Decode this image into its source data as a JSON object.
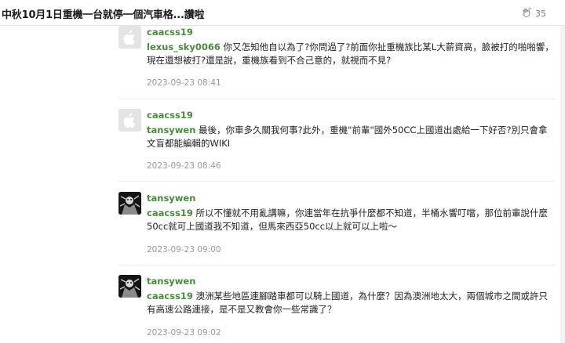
{
  "header": {
    "title": "中秋10月1日重機一台就停一個汽車格...讚啦",
    "like_count": "35"
  },
  "comments": [
    {
      "author": "caacss19",
      "mention": "lexus_sky0066",
      "text": " 你又怎知他自以為了?你問過了?前面你扯重機族比某L大薪資高，臉被打的啪啪響，現在還想被打?還是說，重機族看到不合己意的，就視而不見?",
      "time": "2023-09-23 08:41",
      "avatar": "default-avatar-icon"
    },
    {
      "author": "caacss19",
      "mention": "tansywen",
      "text": " 最後，你車多久關我何事?此外，重機\"前輩\"國外50CC上國道出處給一下好否?別只會拿文盲都能編輯的WIKI",
      "time": "2023-09-23 08:46",
      "avatar": "default-avatar-icon"
    },
    {
      "author": "tansywen",
      "mention": "caacss19",
      "text": " 所以不懂就不用亂講嘛，你連當年在抗爭什麼都不知道，半桶水響叮噹，那位前輩說什麼50cc就可上國道我不知道，但馬來西亞50cc以上就可以上啦～",
      "time": "2023-09-23 09:00",
      "avatar": "photo-avatar-icon"
    },
    {
      "author": "tansywen",
      "mention": "caacss19",
      "text": " 澳洲某些地區連腳踏車都可以騎上國道，為什麼？因為澳洲地太大，兩個城市之間或許只有高速公路連接，是不是又教會你一些常識了？",
      "time": "2023-09-23 09:02",
      "avatar": "photo-avatar-icon"
    }
  ]
}
